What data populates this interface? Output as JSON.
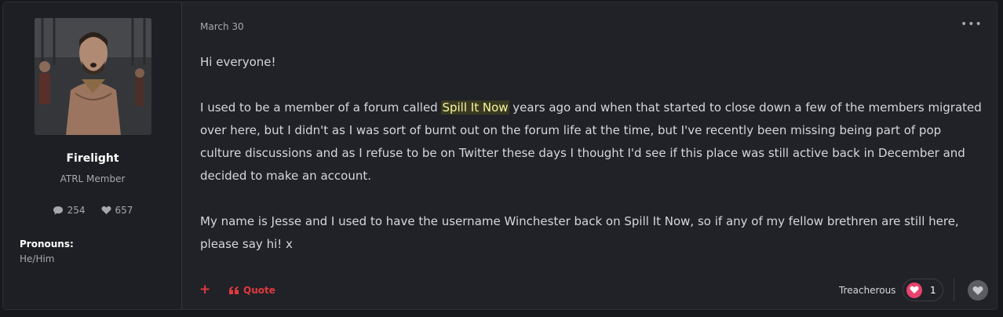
{
  "author": {
    "name": "Firelight",
    "rank": "ATRL Member",
    "post_count": "254",
    "reputation": "657",
    "pronouns_label": "Pronouns:",
    "pronouns_value": "He/Him",
    "avatar_icon": "user-avatar-photo"
  },
  "post": {
    "date": "March 30",
    "menu_label": "•••",
    "greeting": "Hi everyone!",
    "para2_before": "I used to be a member of a forum called ",
    "para2_link": "Spill It Now",
    "para2_after": " years ago and when that started to close down a few of the members migrated over here, but I didn't as I was sort of burnt out on the forum life at the time, but I've recently been missing being part of pop culture discussions and as I refuse to be on Twitter these days I thought I'd see if this place was still active back in December and decided to make an account.",
    "para3": "My name is Jesse and I used to have the username Winchester back on Spill It Now, so if any of my fellow brethren are still here, please say hi! x"
  },
  "actions": {
    "add_label": "+",
    "quote_label": "Quote",
    "quote_icon": "quote-marks-icon",
    "reaction_label": "Treacherous",
    "reaction_count": "1",
    "reaction_icon": "heart-icon",
    "like_icon": "heart-outline-icon"
  },
  "colors": {
    "accent": "#e0393e",
    "mention_text": "#f6f6a0",
    "heart": "#e8436c",
    "background": "#212227"
  }
}
